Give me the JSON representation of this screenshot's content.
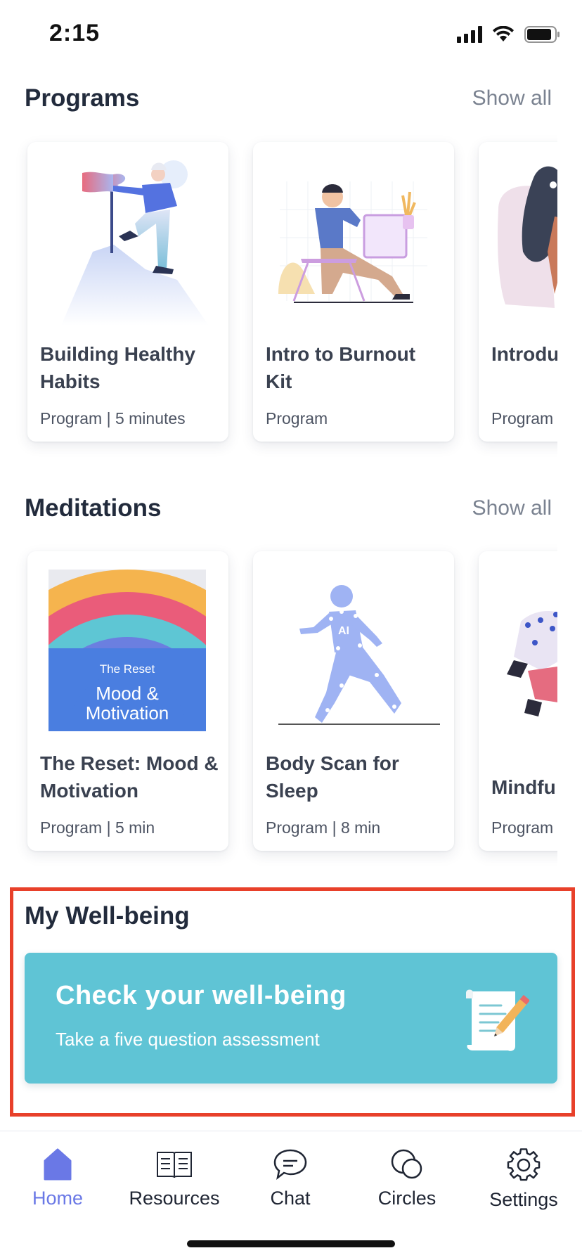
{
  "status_bar": {
    "time": "2:15"
  },
  "programs": {
    "title": "Programs",
    "show_all": "Show all",
    "cards": [
      {
        "title": "Building Healthy Habits",
        "subtitle": "Program | 5 minutes"
      },
      {
        "title": "Intro to Burnout Kit",
        "subtitle": "Program"
      },
      {
        "title": "Introdu Coping",
        "subtitle": "Program"
      }
    ]
  },
  "meditations": {
    "title": "Meditations",
    "show_all": "Show all",
    "cards": [
      {
        "title": "The Reset: Mood & Motivation",
        "subtitle": "Program | 5 min",
        "art_small": "The Reset",
        "art_big": "Mood & Motivation"
      },
      {
        "title": "Body Scan for Sleep",
        "subtitle": "Program | 8 min",
        "art_label": "AI"
      },
      {
        "title": "Mindfu",
        "subtitle": "Program"
      }
    ]
  },
  "wellbeing": {
    "title": "My Well-being",
    "card_title": "Check your well-being",
    "card_subtitle": "Take a five question assessment",
    "icon": "scroll-pen-icon"
  },
  "tab_bar": {
    "active_color": "#6a78e6",
    "tabs": [
      {
        "label": "Home",
        "icon": "home-icon"
      },
      {
        "label": "Resources",
        "icon": "book-icon"
      },
      {
        "label": "Chat",
        "icon": "chat-bubble-icon"
      },
      {
        "label": "Circles",
        "icon": "circles-icon"
      },
      {
        "label": "Settings",
        "icon": "gear-icon"
      }
    ]
  }
}
